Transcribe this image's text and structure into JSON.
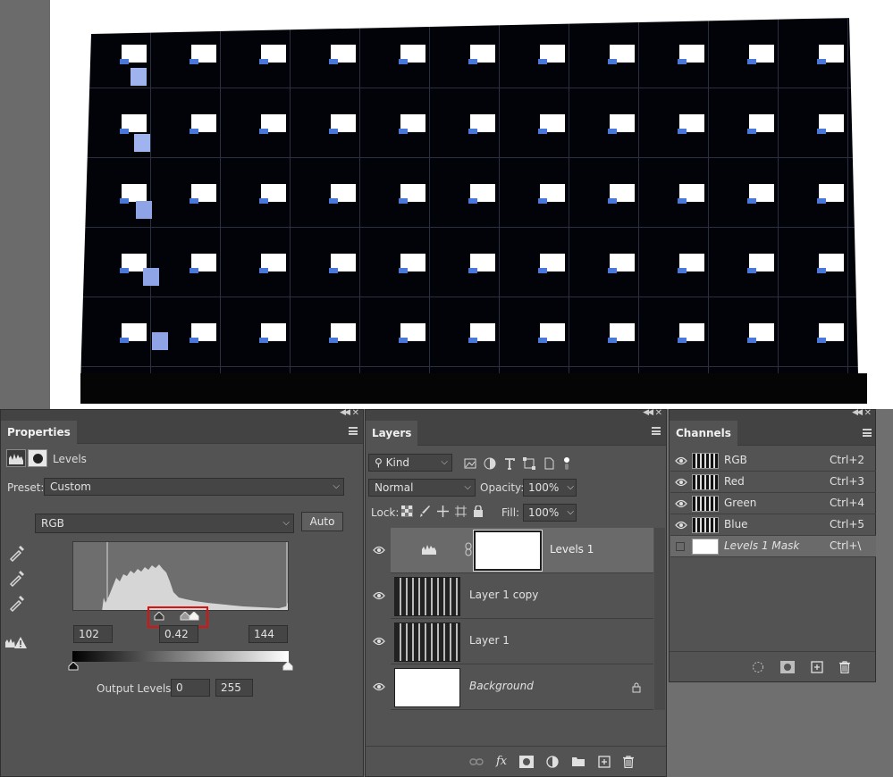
{
  "properties": {
    "tab": "Properties",
    "adjustment_name": "Levels",
    "preset_label": "Preset:",
    "preset_value": "Custom",
    "channel_value": "RGB",
    "auto_button": "Auto",
    "input_black": "102",
    "input_gamma": "0.42",
    "input_white": "144",
    "output_label": "Output Levels:",
    "output_black": "0",
    "output_white": "255"
  },
  "layers": {
    "tab": "Layers",
    "filter_kind": "Kind",
    "blend_mode": "Normal",
    "opacity_label": "Opacity:",
    "opacity_value": "100%",
    "lock_label": "Lock:",
    "fill_label": "Fill:",
    "fill_value": "100%",
    "items": [
      {
        "name": "Levels 1"
      },
      {
        "name": "Layer 1 copy"
      },
      {
        "name": "Layer 1"
      },
      {
        "name": "Background"
      }
    ]
  },
  "channels": {
    "tab": "Channels",
    "items": [
      {
        "name": "RGB",
        "shortcut": "Ctrl+2"
      },
      {
        "name": "Red",
        "shortcut": "Ctrl+3"
      },
      {
        "name": "Green",
        "shortcut": "Ctrl+4"
      },
      {
        "name": "Blue",
        "shortcut": "Ctrl+5"
      },
      {
        "name": "Levels 1 Mask",
        "shortcut": "Ctrl+\\"
      }
    ]
  },
  "icons": {
    "eye": "eye-icon",
    "lock": "lock-icon",
    "eyedropper": "eyedropper-icon",
    "trash": "trash-icon",
    "new": "new-layer-icon",
    "folder": "folder-icon",
    "mask": "mask-icon",
    "fx": "fx-icon",
    "link": "link-icon"
  },
  "colors": {
    "panel_bg": "#535353",
    "highlight_box": "#e0100f"
  }
}
